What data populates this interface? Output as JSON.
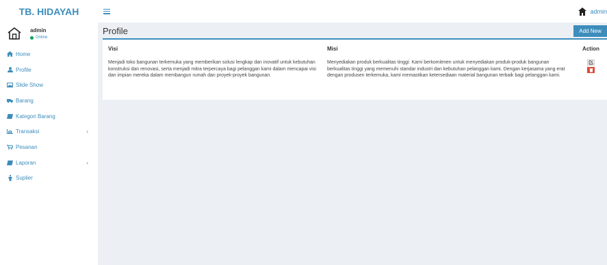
{
  "app": {
    "brand": "TB. HIDAYAH"
  },
  "header": {
    "user_label": "admin"
  },
  "user_panel": {
    "name": "admin",
    "status": "Online"
  },
  "sidebar": {
    "items": [
      {
        "label": "Home",
        "icon": "home-icon"
      },
      {
        "label": "Profile",
        "icon": "user-icon"
      },
      {
        "label": "Slide Show",
        "icon": "image-icon"
      },
      {
        "label": "Barang",
        "icon": "truck-icon"
      },
      {
        "label": "Kategori Barang",
        "icon": "book-icon"
      },
      {
        "label": "Transaksi",
        "icon": "bar-chart-icon",
        "chevron": "‹"
      },
      {
        "label": "Pesanan",
        "icon": "cart-icon"
      },
      {
        "label": "Laporan",
        "icon": "book-icon",
        "chevron": "‹"
      },
      {
        "label": "Suplier",
        "icon": "person-icon"
      }
    ]
  },
  "page": {
    "title": "Profile",
    "add_new": "Add New"
  },
  "table": {
    "headers": {
      "visi": "Visi",
      "misi": "Misi",
      "action": "Action"
    },
    "rows": [
      {
        "visi": "Menjadi toko bangunan terkemuka yang memberikan solusi lengkap dan inovatif untuk kebutuhan konstruksi dan renovasi, serta menjadi mitra terpercaya bagi pelanggan kami dalam mencapai visi dan impian mereka dalam membangun rumah dan proyek-proyek bangunan.",
        "misi": "Menyediakan produk berkualitas tinggi: Kami berkomitmen untuk menyediakan produk-produk bangunan berkualitas tinggi yang memenuhi standar industri dan kebutuhan pelanggan kami. Dengan kerjasama yang erat dengan produsen terkemuka, kami memastikan ketersediaan material bangunan terbaik bagi pelanggan kami.",
        "edit_icon": "edit-icon",
        "delete_icon": "trash-icon"
      }
    ]
  },
  "colors": {
    "primary": "#3c8dbc",
    "danger": "#dd4b39",
    "success": "#00a65a",
    "background": "#ecf0f5"
  }
}
